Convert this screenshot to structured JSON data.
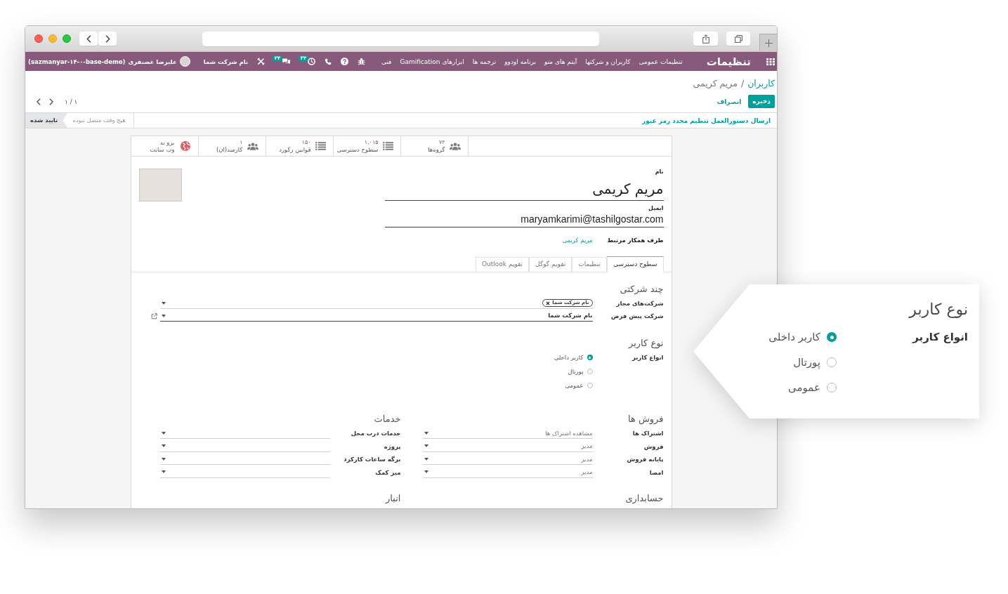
{
  "navbar": {
    "brand": "تنظیمات",
    "menus": [
      "تنظیمات عمومی",
      "کاربران و شرکتها",
      "آیتم های منو",
      "برنامه اودوو",
      "ترجمه ها",
      "ابزارهای Gamification",
      "فنی"
    ],
    "systray": [
      {
        "kind": "debug"
      },
      {
        "kind": "help"
      },
      {
        "kind": "phone"
      },
      {
        "kind": "activity",
        "badge": "۳۴"
      },
      {
        "kind": "messages",
        "badge": "۲۴"
      },
      {
        "kind": "tools"
      }
    ],
    "company": "نام شرکت شما",
    "user": {
      "name": "علیرضا غضنفری",
      "database": "(sazmanyar-۱۴-۰-base-demo)"
    }
  },
  "control_panel": {
    "breadcrumb": {
      "parent": "کاربران",
      "separator": "/",
      "current": "مریم کریمی"
    },
    "save": "ذخیره",
    "discard": "انصراف",
    "pager": "۱ / ۱"
  },
  "status_row": {
    "action": "ارسال دستورالعمل تنظیم مجدد رمز عبور",
    "stages": [
      {
        "label": "هیچ وقت متصل نبوده",
        "selected": false
      },
      {
        "label": "تایید شده",
        "selected": true
      }
    ]
  },
  "stat_buttons": [
    {
      "kind": "people",
      "value": "۷۴",
      "label": "گروه‌ها"
    },
    {
      "kind": "list",
      "value": "۱,۰۱۵",
      "label": "سطوح دسترسی"
    },
    {
      "kind": "list",
      "value": "۱۵۰",
      "label": "قوانین رکورد"
    },
    {
      "kind": "people",
      "value": "۱",
      "label": "کارمند(ان)"
    },
    {
      "kind": "website",
      "lines": [
        "برو به",
        "وب سایت"
      ]
    }
  ],
  "form": {
    "name": {
      "label": "نام",
      "value": "مریم کریمی"
    },
    "email": {
      "label": "ایمیل",
      "value": "maryamkarimi@tashilgostar.com"
    },
    "partner": {
      "label": "طرف همکار مرتبط",
      "value": "مریم کریمی"
    }
  },
  "tabs": [
    {
      "label": "سطوح دسترسی",
      "selected": true
    },
    {
      "label": "تنظیمات",
      "selected": false
    },
    {
      "label": "تقویم گوگل",
      "selected": false
    },
    {
      "label": "تقویم Outlook",
      "selected": false
    }
  ],
  "multi_company": {
    "title": "چند شرکتی",
    "allowed": {
      "label": "شرکت‌های مجاز",
      "tags": [
        "نام شرکت شما"
      ]
    },
    "default": {
      "label": "شرکت پیش فرض",
      "value": "نام شرکت شما"
    }
  },
  "user_type": {
    "title": "نوع کاربر",
    "label": "انواع کاربر",
    "options": [
      {
        "label": "کاربر داخلی",
        "selected": true
      },
      {
        "label": "پورتال",
        "selected": false
      },
      {
        "label": "عمومی",
        "selected": false
      }
    ]
  },
  "sections": [
    {
      "title": "فروش ها",
      "fields": [
        {
          "label": "اشتراک ها",
          "value": "مشاهده اشتراک ها"
        },
        {
          "label": "فروش",
          "value": "مدیر"
        },
        {
          "label": "پایانه فروش",
          "value": "مدیر"
        },
        {
          "label": "امضا",
          "value": "مدیر"
        }
      ]
    },
    {
      "title": "خدمات",
      "fields": [
        {
          "label": "خدمات درب محل"
        },
        {
          "label": "پروژه"
        },
        {
          "label": "برگه ساعات کارکرد"
        },
        {
          "label": "میز کمک"
        }
      ]
    },
    {
      "title": "حسابداری"
    },
    {
      "title": "انبار"
    }
  ],
  "callout": {
    "title": "نوع کاربر",
    "label": "انواع کاربر",
    "options": [
      {
        "label": "کاربر داخلی",
        "selected": true
      },
      {
        "label": "پورتال",
        "selected": false
      },
      {
        "label": "عمومی",
        "selected": false
      }
    ]
  }
}
